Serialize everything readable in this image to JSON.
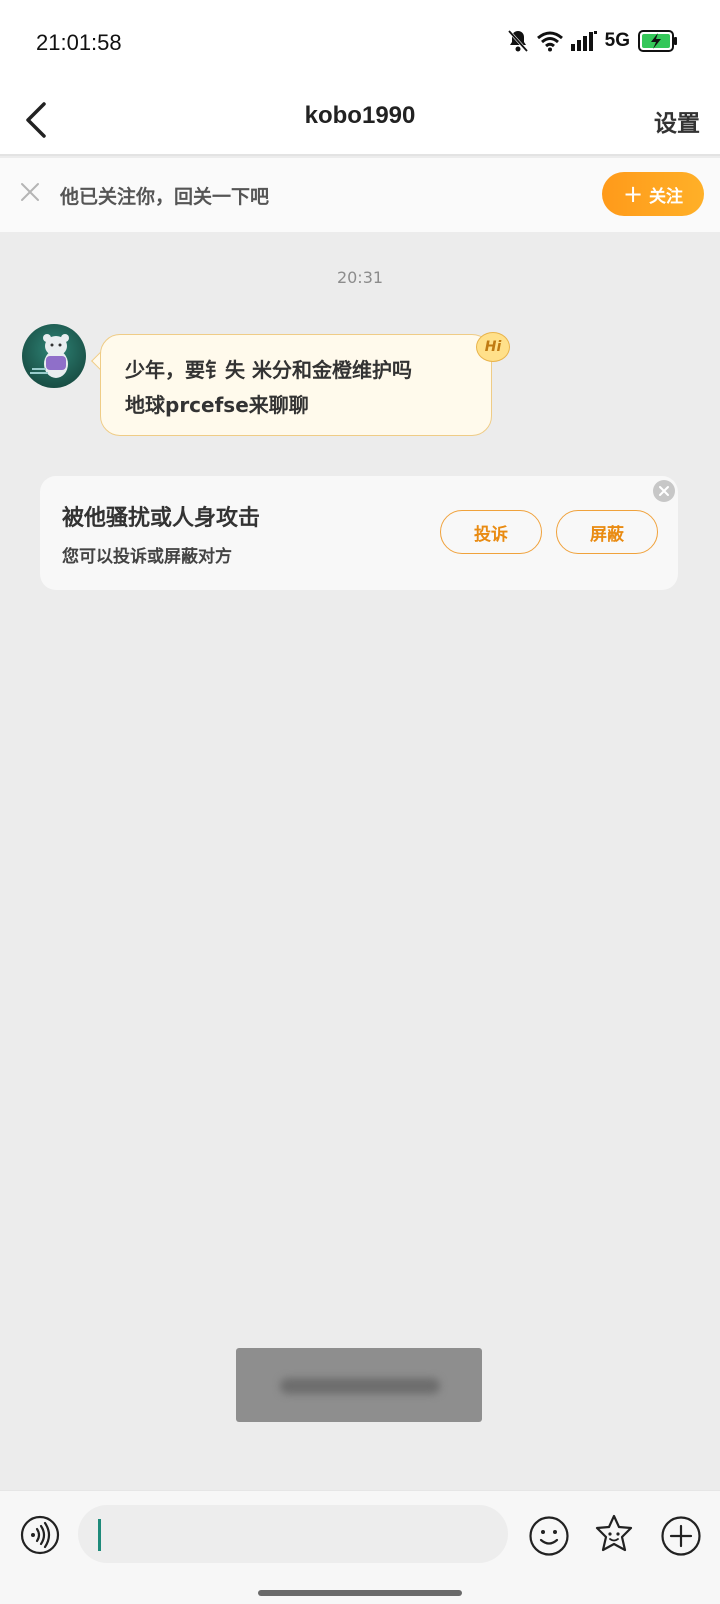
{
  "status_bar": {
    "time": "21:01:58",
    "network": "5G",
    "icons": [
      "mute-bell-icon",
      "wifi-icon",
      "signal-icon",
      "battery-charging-icon"
    ]
  },
  "nav": {
    "title": "kobo1990",
    "settings_label": "设置",
    "back_icon": "chevron-left-icon"
  },
  "follow_banner": {
    "text": "他已关注你，回关一下吧",
    "button_label": "关注",
    "button_icon": "plus-icon",
    "accent_color": "#ff9f1c"
  },
  "chat": {
    "time_separator": "20:31",
    "messages": [
      {
        "sender": "other",
        "lines": [
          "少年，要钅失 米分和金橙维护吗",
          "地球prcefse来聊聊"
        ],
        "badge": "Hi"
      }
    ]
  },
  "report_card": {
    "title": "被他骚扰或人身攻击",
    "subtitle": "您可以投诉或屏蔽对方",
    "report_label": "投诉",
    "block_label": "屏蔽"
  },
  "input_bar": {
    "placeholder": "",
    "icons": [
      "voice-icon",
      "emoji-icon",
      "sticker-icon",
      "plus-circle-icon"
    ]
  }
}
